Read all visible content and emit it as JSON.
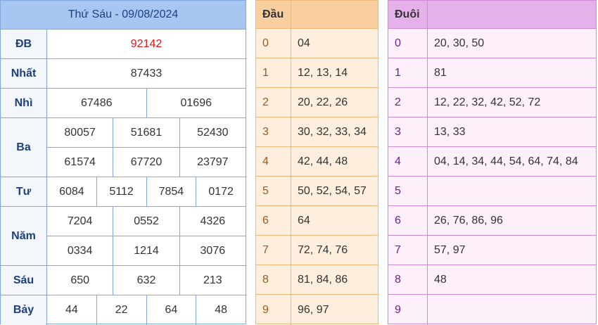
{
  "results": {
    "title": "Thứ Sáu - 09/08/2024",
    "rows": [
      {
        "label": "ĐB",
        "lines": [
          [
            "92142"
          ]
        ]
      },
      {
        "label": "Nhất",
        "lines": [
          [
            "87433"
          ]
        ]
      },
      {
        "label": "Nhì",
        "lines": [
          [
            "67486",
            "01696"
          ]
        ]
      },
      {
        "label": "Ba",
        "lines": [
          [
            "80057",
            "51681",
            "52430"
          ],
          [
            "61574",
            "67720",
            "23797"
          ]
        ]
      },
      {
        "label": "Tư",
        "lines": [
          [
            "6084",
            "5112",
            "7854",
            "0172"
          ]
        ]
      },
      {
        "label": "Năm",
        "lines": [
          [
            "7204",
            "0552",
            "4326"
          ],
          [
            "0334",
            "1214",
            "3076"
          ]
        ]
      },
      {
        "label": "Sáu",
        "lines": [
          [
            "650",
            "632",
            "213"
          ]
        ]
      },
      {
        "label": "Bảy",
        "lines": [
          [
            "44",
            "22",
            "64",
            "48"
          ]
        ]
      }
    ]
  },
  "dau": {
    "header": "Đầu",
    "rows": [
      {
        "digit": "0",
        "values": "04"
      },
      {
        "digit": "1",
        "values": "12, 13, 14"
      },
      {
        "digit": "2",
        "values": "20, 22, 26"
      },
      {
        "digit": "3",
        "values": "30, 32, 33, 34"
      },
      {
        "digit": "4",
        "values": "42, 44, 48"
      },
      {
        "digit": "5",
        "values": "50, 52, 54, 57"
      },
      {
        "digit": "6",
        "values": "64"
      },
      {
        "digit": "7",
        "values": "72, 74, 76"
      },
      {
        "digit": "8",
        "values": "81, 84, 86"
      },
      {
        "digit": "9",
        "values": "96, 97"
      }
    ]
  },
  "duoi": {
    "header": "Đuôi",
    "rows": [
      {
        "digit": "0",
        "values": "20, 30, 50"
      },
      {
        "digit": "1",
        "values": "81"
      },
      {
        "digit": "2",
        "values": "12, 22, 32, 42, 52, 72"
      },
      {
        "digit": "3",
        "values": "13, 33"
      },
      {
        "digit": "4",
        "values": "04, 14, 34, 44, 54, 64, 74, 84"
      },
      {
        "digit": "5",
        "values": ""
      },
      {
        "digit": "6",
        "values": "26, 76, 86, 96"
      },
      {
        "digit": "7",
        "values": "57, 97"
      },
      {
        "digit": "8",
        "values": "48"
      },
      {
        "digit": "9",
        "values": ""
      }
    ]
  },
  "colors": {
    "special_prize": "#e0161c",
    "results_header": "#a7c6f2",
    "dau_header": "#f9cfa0",
    "duoi_header": "#e6b0ea"
  }
}
